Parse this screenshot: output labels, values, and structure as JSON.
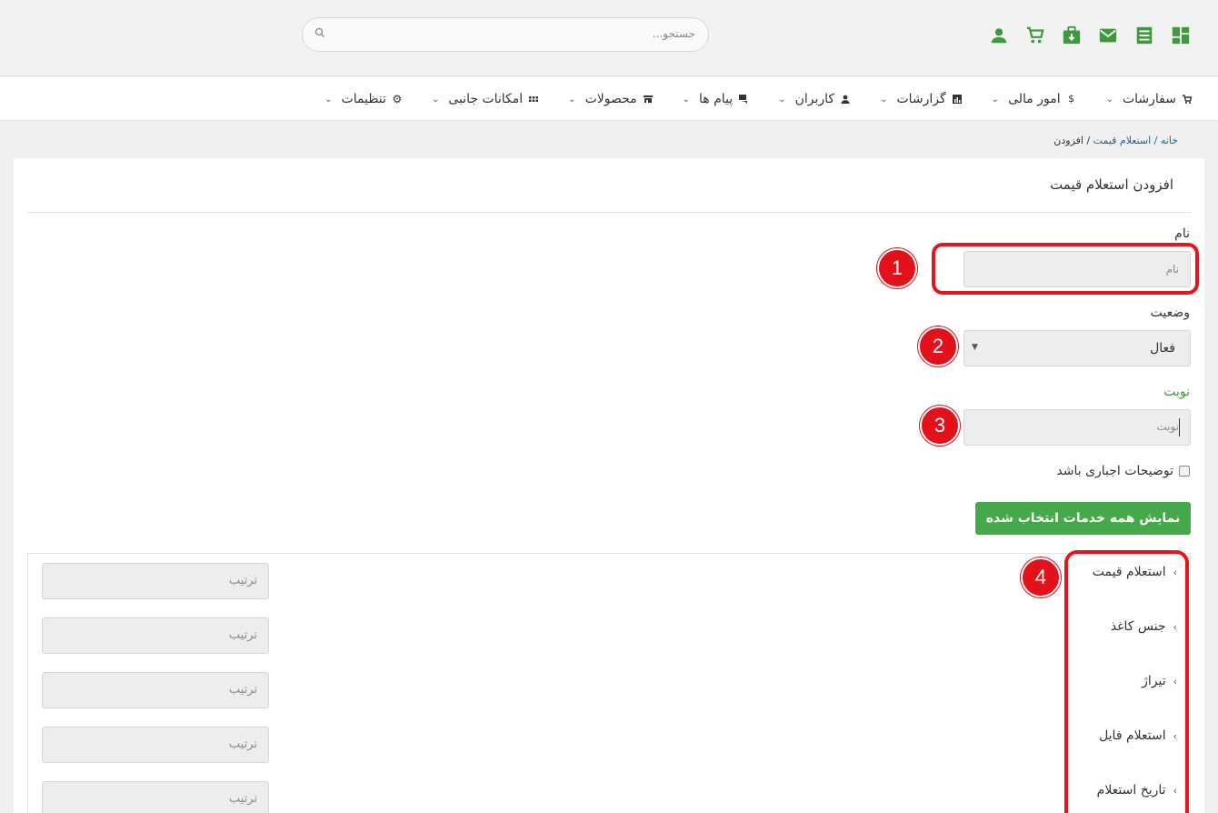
{
  "header": {
    "search_placeholder": "جستجو...",
    "icons": [
      "dashboard-icon",
      "receipt-icon",
      "mail-icon",
      "package-icon",
      "cart-icon",
      "user-icon"
    ],
    "icon_color": "#3c9a3c"
  },
  "nav": {
    "items": [
      {
        "label": "سفارشات",
        "icon": "cart-icon"
      },
      {
        "label": "امور مالی",
        "icon": "dollar-icon"
      },
      {
        "label": "گزارشات",
        "icon": "chart-icon"
      },
      {
        "label": "کاربران",
        "icon": "user-icon"
      },
      {
        "label": "پیام ها",
        "icon": "chat-icon"
      },
      {
        "label": "محصولات",
        "icon": "store-icon"
      },
      {
        "label": "امکانات جانبی",
        "icon": "grid-icon"
      },
      {
        "label": "تنظیمات",
        "icon": "gear-icon"
      }
    ]
  },
  "breadcrumb": {
    "home": "خانه /",
    "section": "استعلام قیمت",
    "current": "/ افزودن"
  },
  "form": {
    "title": "افزودن استعلام قیمت",
    "name_label": "نام",
    "name_placeholder": "نام",
    "status_label": "وضعیت",
    "status_value": "فعال",
    "turn_label": "نوبت",
    "turn_placeholder": "نوبت",
    "required_desc_label": "توضیحات اجباری باشد",
    "show_all_button": "نمایش همه خدمات انتخاب شده",
    "accent_color": "#45a94a"
  },
  "services": [
    {
      "label": "استعلام قیمت",
      "order_placeholder": "ترتیب"
    },
    {
      "label": "جنس کاغذ",
      "order_placeholder": "ترتیب"
    },
    {
      "label": "تیراژ",
      "order_placeholder": "ترتیب"
    },
    {
      "label": "استعلام فایل",
      "order_placeholder": "ترتیب"
    },
    {
      "label": "تاریخ استعلام",
      "order_placeholder": "ترتیب"
    }
  ],
  "annotations": {
    "highlight_color": "#e8141c",
    "badges": [
      "1",
      "2",
      "3",
      "4"
    ]
  }
}
